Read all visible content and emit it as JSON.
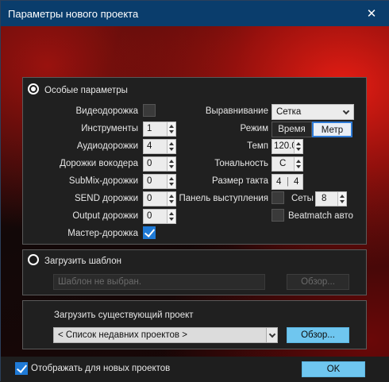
{
  "window": {
    "title": "Параметры нового проекта",
    "close": "✕"
  },
  "special": {
    "radio_label": "Особые параметры",
    "video_track": "Видеодорожка",
    "instruments": {
      "label": "Инструменты",
      "value": "1"
    },
    "audio_tracks": {
      "label": "Аудиодорожки",
      "value": "4"
    },
    "vocoder_tracks": {
      "label": "Дорожки вокодера",
      "value": "0"
    },
    "submix_tracks": {
      "label": "SubMix-дорожки",
      "value": "0"
    },
    "send_tracks": {
      "label": "SEND дорожки",
      "value": "0"
    },
    "output_tracks": {
      "label": "Output дорожки",
      "value": "0"
    },
    "master_track": "Мастер-дорожка",
    "alignment": {
      "label": "Выравнивание",
      "value": "Сетка"
    },
    "mode": {
      "label": "Режим",
      "options": [
        "Время",
        "Метр"
      ],
      "selected": "Метр"
    },
    "tempo": {
      "label": "Темп",
      "value": "120.0"
    },
    "key": {
      "label": "Тональность",
      "value": "C"
    },
    "time_sig": {
      "label": "Размер такта",
      "num": "4",
      "den": "4"
    },
    "perf_panel": "Панель выступления",
    "sets": {
      "label": "Сеты",
      "value": "8"
    },
    "beatmatch": "Beatmatch авто"
  },
  "template": {
    "radio_label": "Загрузить шаблон",
    "placeholder": "Шаблон не выбран.",
    "browse": "Обзор..."
  },
  "existing": {
    "label": "Загрузить существующий проект",
    "recent": "< Список недавних проектов >",
    "browse": "Обзор..."
  },
  "footer": {
    "show_for_new": "Отображать для новых проектов",
    "ok": "OK"
  },
  "colors": {
    "titlebar": "#0a3d6c",
    "accent": "#1f7ad6",
    "button_blue": "#6fc6ef"
  }
}
